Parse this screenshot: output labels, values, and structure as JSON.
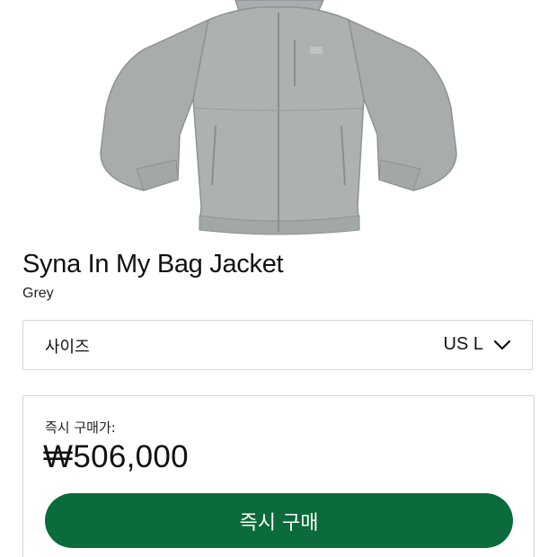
{
  "product": {
    "name": "Syna In My Bag Jacket",
    "color": "Grey",
    "image_icon": "jacket-product-photo"
  },
  "size_selector": {
    "label": "사이즈",
    "value": "US L",
    "icon": "chevron-down-icon"
  },
  "purchase": {
    "label": "즉시 구매가:",
    "price": "₩506,000",
    "button_label": "즉시 구매",
    "button_color": "#0b6b3a"
  }
}
